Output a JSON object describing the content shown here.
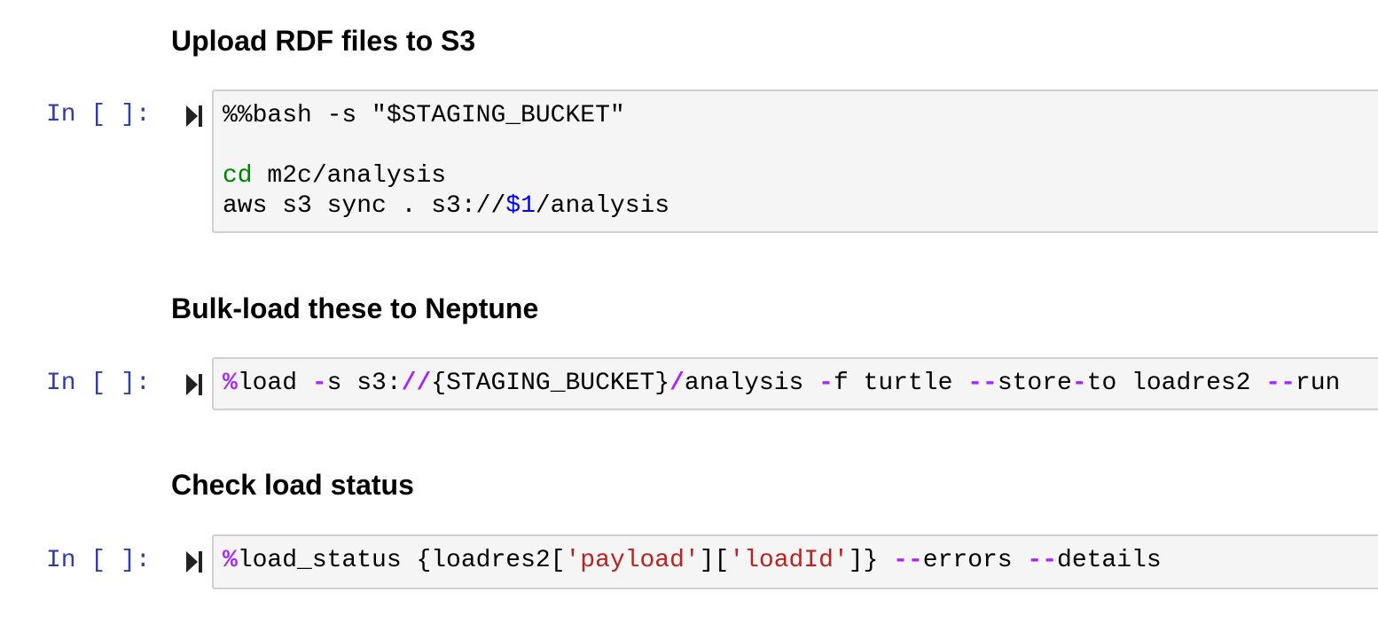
{
  "cells": [
    {
      "heading": "Upload RDF files to S3",
      "prompt": "In [ ]:",
      "lines": [
        [
          "%%bash -s \"$STAGING_BUCKET\""
        ],
        [
          ""
        ],
        [
          "cd",
          " m2c/analysis"
        ],
        [
          "aws s3 sync . s3://",
          "$1",
          "/analysis"
        ]
      ]
    },
    {
      "heading": "Bulk-load these to Neptune",
      "prompt": "In [ ]:",
      "lines": [
        [
          "%",
          "load ",
          "-",
          "s s3:",
          "//",
          "{STAGING_BUCKET}",
          "/",
          "analysis ",
          "-",
          "f turtle ",
          "--",
          "store",
          "-",
          "to loadres2 ",
          "--",
          "run"
        ]
      ]
    },
    {
      "heading": "Check load status",
      "prompt": "In [ ]:",
      "lines": [
        [
          "%",
          "load_status {loadres2[",
          "'payload'",
          "][",
          "'loadId'",
          "]} ",
          "--",
          "errors ",
          "--",
          "details"
        ]
      ]
    }
  ],
  "icons": {
    "run_button": "step-forward-icon"
  },
  "colors": {
    "prompt": "#303f9f",
    "cell_background": "#f5f5f5",
    "cell_border": "#cfcfcf",
    "keyword_green": "#008000",
    "variable_blue": "#0000ff",
    "operator_purple": "#aa22ff",
    "string_red": "#ba2121"
  }
}
